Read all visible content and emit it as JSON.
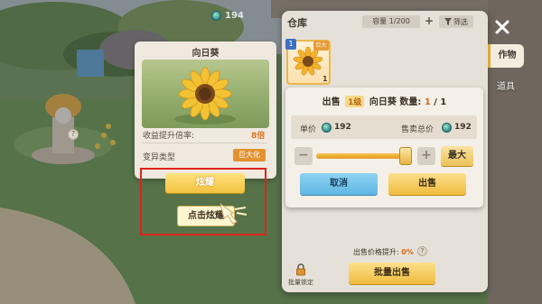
{
  "currency": {
    "icon": "teal-coin-icon",
    "amount": "194"
  },
  "detail": {
    "title": "向日葵",
    "image_icon": "sunflower-icon",
    "rate_label": "收益提升倍率:",
    "rate_help": "?",
    "rate_value": "8倍",
    "mutation_label": "变异类型",
    "mutation_value": "巨大化",
    "glow_button": "炫耀",
    "tip_text": "点击炫耀"
  },
  "warehouse": {
    "title": "仓库",
    "capacity": "容量 1/200",
    "capacity_add": "+",
    "filter_label": "筛选",
    "slot": {
      "badge": "1",
      "mutation_tag": "巨大",
      "quantity": "1",
      "icon": "sunflower-icon"
    },
    "tabs": {
      "crops": "作物",
      "tools": "道具"
    },
    "sell": {
      "prefix": "出售",
      "level": "1级",
      "item": "向日葵",
      "qty_label": "数量:",
      "qty_current": "1",
      "qty_total": "/ 1",
      "unit_price_label": "单价",
      "unit_price": "192",
      "total_price_label": "售卖总价",
      "total_price": "192",
      "minus": "−",
      "plus": "+",
      "max": "最大",
      "cancel": "取消",
      "confirm": "出售",
      "slider_fraction": 1.0
    },
    "boost_label": "出售价格提升:",
    "boost_value": "0%",
    "boost_help": "?",
    "lock_label": "批量锁定",
    "batch_sell": "批量出售"
  },
  "colors": {
    "accent": "#f0bb3e",
    "cancel": "#5fb6e3",
    "highlight": "#e0231e"
  }
}
